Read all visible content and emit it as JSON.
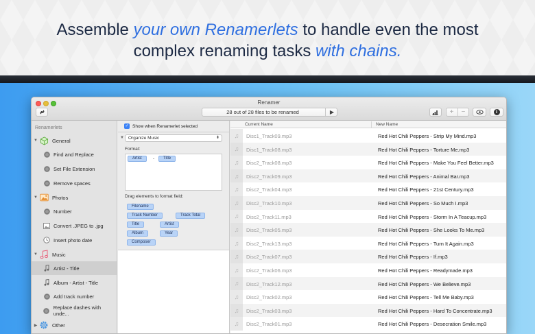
{
  "hero": {
    "line1_plain": "Assemble ",
    "line1_em": "your own Renamerlets",
    "line1_rest": " to handle even the most",
    "line2_plain": "complex renaming tasks ",
    "line2_em": "with chains."
  },
  "window": {
    "title": "Renamer",
    "status": "28 out of 28 files to be renamed",
    "play_glyph": "▶",
    "plus": "+",
    "minus": "−",
    "info_glyph": "i"
  },
  "sidebar": {
    "heading": "Renamerlets",
    "groups": [
      {
        "label": "General",
        "icon": "cube-icon",
        "items": [
          "Find and Replace",
          "Set File Extension",
          "Remove spaces"
        ]
      },
      {
        "label": "Photos",
        "icon": "photo-icon",
        "items": [
          "Number",
          "Convert .JPEG to .jpg",
          "Insert photo date"
        ]
      },
      {
        "label": "Music",
        "icon": "music-note-icon",
        "items": [
          "Artist - Title",
          "Album - Artist - Title",
          "Add track number",
          "Replace dashes with unde..."
        ]
      },
      {
        "label": "Other",
        "icon": "gear-icon",
        "items": []
      }
    ],
    "selected": "Artist - Title"
  },
  "middle": {
    "show_when_selected": "Show when Renamerlet selected",
    "preset": "Organize Music",
    "format_label": "Format:",
    "format_tokens": [
      "Artist",
      "Title"
    ],
    "format_separator": "-",
    "drag_label": "Drag elements to format field:",
    "drag_tokens": [
      "Filename",
      "Track Number",
      "Track Total",
      "Title",
      "Artist",
      "Album",
      "Year",
      "Composer"
    ]
  },
  "table": {
    "columns": [
      "Current Name",
      "New Name"
    ],
    "rows": [
      [
        "Disc1_Track09.mp3",
        "Red Hot Chili Peppers - Strip My Mind.mp3"
      ],
      [
        "Disc1_Track08.mp3",
        "Red Hot Chili Peppers - Torture Me.mp3"
      ],
      [
        "Disc2_Track08.mp3",
        "Red Hot Chili Peppers - Make You Feel Better.mp3"
      ],
      [
        "Disc2_Track09.mp3",
        "Red Hot Chili Peppers - Animal Bar.mp3"
      ],
      [
        "Disc2_Track04.mp3",
        "Red Hot Chili Peppers - 21st Century.mp3"
      ],
      [
        "Disc2_Track10.mp3",
        "Red Hot Chili Peppers - So Much I.mp3"
      ],
      [
        "Disc2_Track11.mp3",
        "Red Hot Chili Peppers - Storm In A Teacup.mp3"
      ],
      [
        "Disc2_Track05.mp3",
        "Red Hot Chili Peppers - She Looks To Me.mp3"
      ],
      [
        "Disc2_Track13.mp3",
        "Red Hot Chili Peppers - Turn It Again.mp3"
      ],
      [
        "Disc2_Track07.mp3",
        "Red Hot Chili Peppers - If.mp3"
      ],
      [
        "Disc2_Track06.mp3",
        "Red Hot Chili Peppers - Readymade.mp3"
      ],
      [
        "Disc2_Track12.mp3",
        "Red Hot Chili Peppers - We Believe.mp3"
      ],
      [
        "Disc2_Track02.mp3",
        "Red Hot Chili Peppers - Tell Me Baby.mp3"
      ],
      [
        "Disc2_Track03.mp3",
        "Red Hot Chili Peppers - Hard To Concentrate.mp3"
      ],
      [
        "Disc2_Track01.mp3",
        "Red Hot Chili Peppers - Desecration Smile.mp3"
      ]
    ]
  },
  "colors": {
    "accent": "#2f6fe0",
    "token_bg": "#b8d3f7",
    "background_blue": "#3d9cf0"
  }
}
